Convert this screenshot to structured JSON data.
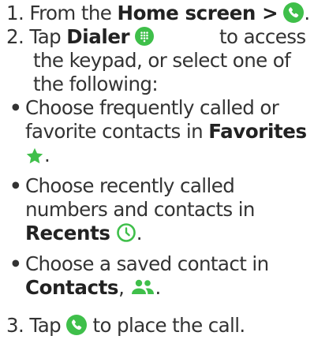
{
  "colors": {
    "text": "#333333",
    "accent_green": "#3fbf4a",
    "icon_white": "#ffffff"
  },
  "icons": {
    "phone": "phone-icon",
    "dialer": "dialpad-icon",
    "favorites": "star-icon",
    "recents": "clock-icon",
    "contacts": "people-icon"
  },
  "steps": {
    "step1": {
      "number": "1.",
      "text_before": "From the ",
      "bold": "Home screen >",
      "text_after": "."
    },
    "step2": {
      "number": "2.",
      "text_before": "Tap ",
      "bold": "Dialer",
      "text_after": " to access the keypad, or select one of the following:",
      "bullets": [
        {
          "marker": "•",
          "text": "Choose frequently called or favorite contacts in ",
          "bold": "Favorites",
          "suffix": "."
        },
        {
          "marker": "•",
          "text": "Choose recently called numbers and contacts in ",
          "bold": "Recents",
          "suffix": "."
        },
        {
          "marker": "•",
          "text": "Choose a saved contact in ",
          "bold": "Contacts",
          "mid": ",",
          "suffix": "."
        }
      ]
    },
    "step3": {
      "number": "3.",
      "text_before": "Tap ",
      "text_after": " to place the call."
    }
  }
}
